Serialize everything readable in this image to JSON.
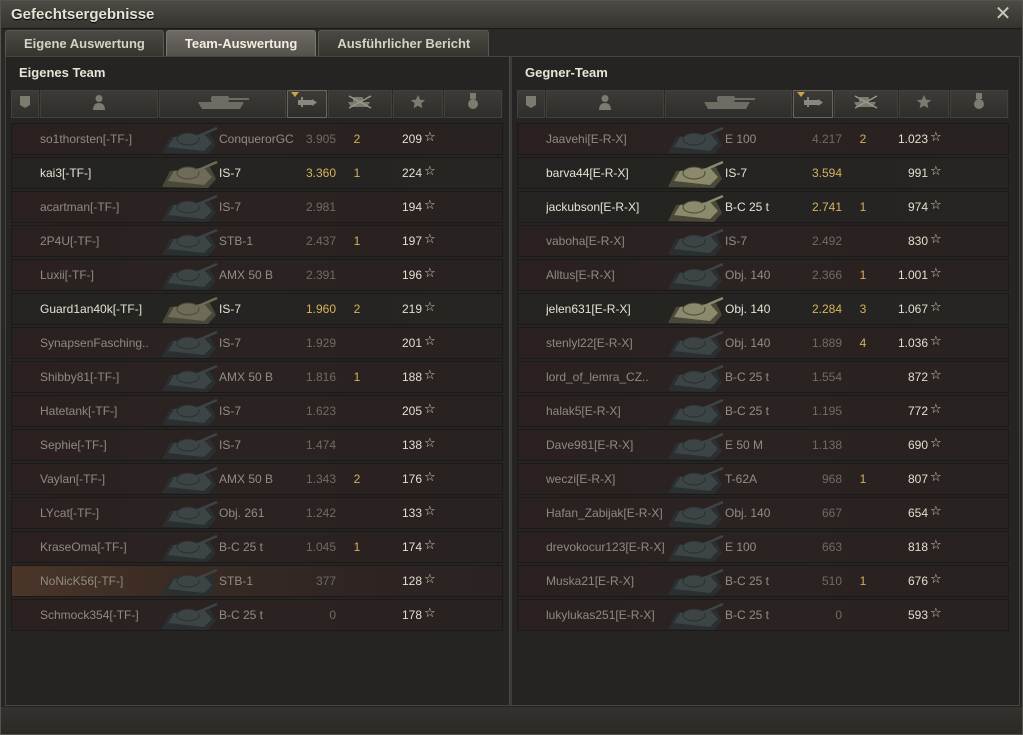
{
  "window": {
    "title": "Gefechtsergebnisse",
    "close_glyph": "✕"
  },
  "tabs": [
    {
      "label": "Eigene Auswertung",
      "active": false
    },
    {
      "label": "Team-Auswertung",
      "active": true
    },
    {
      "label": "Ausführlicher Bericht",
      "active": false
    }
  ],
  "columns": [
    {
      "icon": "squad-icon"
    },
    {
      "icon": "player-icon"
    },
    {
      "icon": "tank-icon"
    },
    {
      "icon": "damage-icon",
      "sorted": true
    },
    {
      "icon": "kills-icon"
    },
    {
      "icon": "star-icon"
    },
    {
      "icon": "medal-icon"
    }
  ],
  "own_team": {
    "title": "Eigenes Team",
    "players": [
      {
        "name": "so1thorsten[-TF-]",
        "vehicle": "ConquerorGC",
        "damage": "3.905",
        "kills": "2",
        "xp": "209",
        "alive": false,
        "self": false
      },
      {
        "name": "kai3[-TF-]",
        "vehicle": "IS-7",
        "damage": "3.360",
        "kills": "1",
        "xp": "224",
        "alive": true,
        "self": false
      },
      {
        "name": "acartman[-TF-]",
        "vehicle": "IS-7",
        "damage": "2.981",
        "kills": "",
        "xp": "194",
        "alive": false,
        "self": false
      },
      {
        "name": "2P4U[-TF-]",
        "vehicle": "STB-1",
        "damage": "2.437",
        "kills": "1",
        "xp": "197",
        "alive": false,
        "self": false
      },
      {
        "name": "Luxii[-TF-]",
        "vehicle": "AMX 50 B",
        "damage": "2.391",
        "kills": "",
        "xp": "196",
        "alive": false,
        "self": false
      },
      {
        "name": "Guard1an40k[-TF-]",
        "vehicle": "IS-7",
        "damage": "1.960",
        "kills": "2",
        "xp": "219",
        "alive": true,
        "self": false
      },
      {
        "name": "SynapsenFasching..",
        "vehicle": "IS-7",
        "damage": "1.929",
        "kills": "",
        "xp": "201",
        "alive": false,
        "self": false
      },
      {
        "name": "Shibby81[-TF-]",
        "vehicle": "AMX 50 B",
        "damage": "1.816",
        "kills": "1",
        "xp": "188",
        "alive": false,
        "self": false
      },
      {
        "name": "Hatetank[-TF-]",
        "vehicle": "IS-7",
        "damage": "1.623",
        "kills": "",
        "xp": "205",
        "alive": false,
        "self": false
      },
      {
        "name": "Sephie[-TF-]",
        "vehicle": "IS-7",
        "damage": "1.474",
        "kills": "",
        "xp": "138",
        "alive": false,
        "self": false
      },
      {
        "name": "Vaylan[-TF-]",
        "vehicle": "AMX 50 B",
        "damage": "1.343",
        "kills": "2",
        "xp": "176",
        "alive": false,
        "self": false
      },
      {
        "name": "LYcat[-TF-]",
        "vehicle": "Obj. 261",
        "damage": "1.242",
        "kills": "",
        "xp": "133",
        "alive": false,
        "self": false
      },
      {
        "name": "KraseOma[-TF-]",
        "vehicle": "B-C 25 t",
        "damage": "1.045",
        "kills": "1",
        "xp": "174",
        "alive": false,
        "self": false
      },
      {
        "name": "NoNicK56[-TF-]",
        "vehicle": "STB-1",
        "damage": "377",
        "kills": "",
        "xp": "128",
        "alive": false,
        "self": true
      },
      {
        "name": "Schmock354[-TF-]",
        "vehicle": "B-C 25 t",
        "damage": "0",
        "kills": "",
        "xp": "178",
        "alive": false,
        "self": false
      }
    ]
  },
  "enemy_team": {
    "title": "Gegner-Team",
    "players": [
      {
        "name": "Jaavehi[E-R-X]",
        "vehicle": "E 100",
        "damage": "4.217",
        "kills": "2",
        "xp": "1.023",
        "alive": false
      },
      {
        "name": "barva44[E-R-X]",
        "vehicle": "IS-7",
        "damage": "3.594",
        "kills": "",
        "xp": "991",
        "alive": true
      },
      {
        "name": "jackubson[E-R-X]",
        "vehicle": "B-C 25 t",
        "damage": "2.741",
        "kills": "1",
        "xp": "974",
        "alive": true
      },
      {
        "name": "vaboha[E-R-X]",
        "vehicle": "IS-7",
        "damage": "2.492",
        "kills": "",
        "xp": "830",
        "alive": false
      },
      {
        "name": "Alltus[E-R-X]",
        "vehicle": "Obj. 140",
        "damage": "2.366",
        "kills": "1",
        "xp": "1.001",
        "alive": false
      },
      {
        "name": "jelen631[E-R-X]",
        "vehicle": "Obj. 140",
        "damage": "2.284",
        "kills": "3",
        "xp": "1.067",
        "alive": true
      },
      {
        "name": "stenlyl22[E-R-X]",
        "vehicle": "Obj. 140",
        "damage": "1.889",
        "kills": "4",
        "xp": "1.036",
        "alive": false
      },
      {
        "name": "lord_of_lemra_CZ..",
        "vehicle": "B-C 25 t",
        "damage": "1.554",
        "kills": "",
        "xp": "872",
        "alive": false
      },
      {
        "name": "halak5[E-R-X]",
        "vehicle": "B-C 25 t",
        "damage": "1.195",
        "kills": "",
        "xp": "772",
        "alive": false
      },
      {
        "name": "Dave981[E-R-X]",
        "vehicle": "E 50 M",
        "damage": "1.138",
        "kills": "",
        "xp": "690",
        "alive": false
      },
      {
        "name": "weczi[E-R-X]",
        "vehicle": "T-62A",
        "damage": "968",
        "kills": "1",
        "xp": "807",
        "alive": false
      },
      {
        "name": "Hafan_Zabijak[E-R-X]",
        "vehicle": "Obj. 140",
        "damage": "667",
        "kills": "",
        "xp": "654",
        "alive": false
      },
      {
        "name": "drevokocur123[E-R-X]",
        "vehicle": "E 100",
        "damage": "663",
        "kills": "",
        "xp": "818",
        "alive": false
      },
      {
        "name": "Muska21[E-R-X]",
        "vehicle": "B-C 25 t",
        "damage": "510",
        "kills": "1",
        "xp": "676",
        "alive": false
      },
      {
        "name": "lukylukas251[E-R-X]",
        "vehicle": "B-C 25 t",
        "damage": "0",
        "kills": "",
        "xp": "593",
        "alive": false
      }
    ]
  },
  "star_glyph": "☆",
  "colors": {
    "alive_text": "#e6e2d4",
    "dead_text": "#8f8b80",
    "damage_highlight": "#d8b35e",
    "self_row": "#4a3528"
  }
}
